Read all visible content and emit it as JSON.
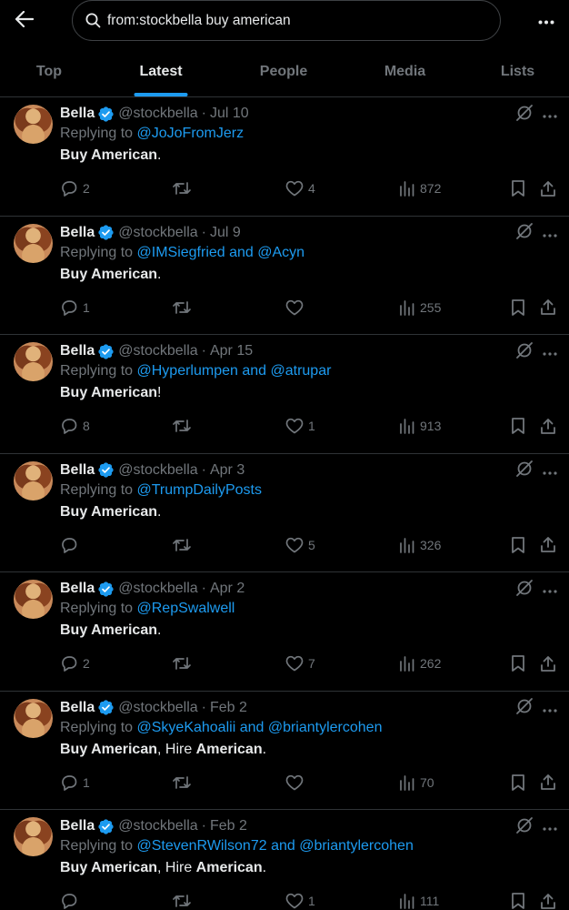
{
  "search": {
    "query": "from:stockbella buy american"
  },
  "tabs": [
    {
      "label": "Top",
      "active": false
    },
    {
      "label": "Latest",
      "active": true
    },
    {
      "label": "People",
      "active": false
    },
    {
      "label": "Media",
      "active": false
    },
    {
      "label": "Lists",
      "active": false
    }
  ],
  "colors": {
    "accent": "#1d9bf0",
    "muted": "#71767b",
    "text": "#e7e9ea",
    "background": "#000000",
    "divider": "#2f3336"
  },
  "icons": [
    "back-arrow-icon",
    "search-icon",
    "more-icon",
    "verified-badge-icon",
    "grok-icon",
    "reply-icon",
    "retweet-icon",
    "like-icon",
    "views-icon",
    "bookmark-icon",
    "share-icon"
  ],
  "tweets": [
    {
      "name": "Bella",
      "handle": "@stockbella",
      "date": "Jul 10",
      "replying_prefix": "Replying to",
      "replying": [
        {
          "type": "link",
          "text": "@JoJoFromJerz"
        }
      ],
      "body": [
        {
          "bold": true,
          "text": "Buy American"
        },
        {
          "bold": false,
          "text": "."
        }
      ],
      "replies": "2",
      "retweets": "",
      "likes": "4",
      "views": "872"
    },
    {
      "name": "Bella",
      "handle": "@stockbella",
      "date": "Jul 9",
      "replying_prefix": "Replying to",
      "replying": [
        {
          "type": "link",
          "text": "@IMSiegfried and @Acyn"
        }
      ],
      "body": [
        {
          "bold": true,
          "text": "Buy American"
        },
        {
          "bold": false,
          "text": "."
        }
      ],
      "replies": "1",
      "retweets": "",
      "likes": "",
      "views": "255"
    },
    {
      "name": "Bella",
      "handle": "@stockbella",
      "date": "Apr 15",
      "replying_prefix": "Replying to",
      "replying": [
        {
          "type": "link",
          "text": "@Hyperlumpen and @atrupar"
        }
      ],
      "body": [
        {
          "bold": true,
          "text": "Buy American"
        },
        {
          "bold": false,
          "text": "!"
        }
      ],
      "replies": "8",
      "retweets": "",
      "likes": "1",
      "views": "913"
    },
    {
      "name": "Bella",
      "handle": "@stockbella",
      "date": "Apr 3",
      "replying_prefix": "Replying to",
      "replying": [
        {
          "type": "link",
          "text": "@TrumpDailyPosts"
        }
      ],
      "body": [
        {
          "bold": true,
          "text": "Buy American"
        },
        {
          "bold": false,
          "text": "."
        }
      ],
      "replies": "",
      "retweets": "",
      "likes": "5",
      "views": "326"
    },
    {
      "name": "Bella",
      "handle": "@stockbella",
      "date": "Apr 2",
      "replying_prefix": "Replying to",
      "replying": [
        {
          "type": "link",
          "text": "@RepSwalwell"
        }
      ],
      "body": [
        {
          "bold": true,
          "text": "Buy American"
        },
        {
          "bold": false,
          "text": "."
        }
      ],
      "replies": "2",
      "retweets": "",
      "likes": "7",
      "views": "262"
    },
    {
      "name": "Bella",
      "handle": "@stockbella",
      "date": "Feb 2",
      "replying_prefix": "Replying to",
      "replying": [
        {
          "type": "link",
          "text": "@SkyeKahoalii and @briantylercohen"
        }
      ],
      "body": [
        {
          "bold": true,
          "text": "Buy American"
        },
        {
          "bold": false,
          "text": ", Hire "
        },
        {
          "bold": true,
          "text": "American"
        },
        {
          "bold": false,
          "text": "."
        }
      ],
      "replies": "1",
      "retweets": "",
      "likes": "",
      "views": "70"
    },
    {
      "name": "Bella",
      "handle": "@stockbella",
      "date": "Feb 2",
      "replying_prefix": "Replying to",
      "replying": [
        {
          "type": "link",
          "text": "@StevenRWilson72 and @briantylercohen"
        }
      ],
      "body": [
        {
          "bold": true,
          "text": "Buy American"
        },
        {
          "bold": false,
          "text": ", Hire "
        },
        {
          "bold": true,
          "text": "American"
        },
        {
          "bold": false,
          "text": "."
        }
      ],
      "replies": "",
      "retweets": "",
      "likes": "1",
      "views": "111"
    }
  ]
}
